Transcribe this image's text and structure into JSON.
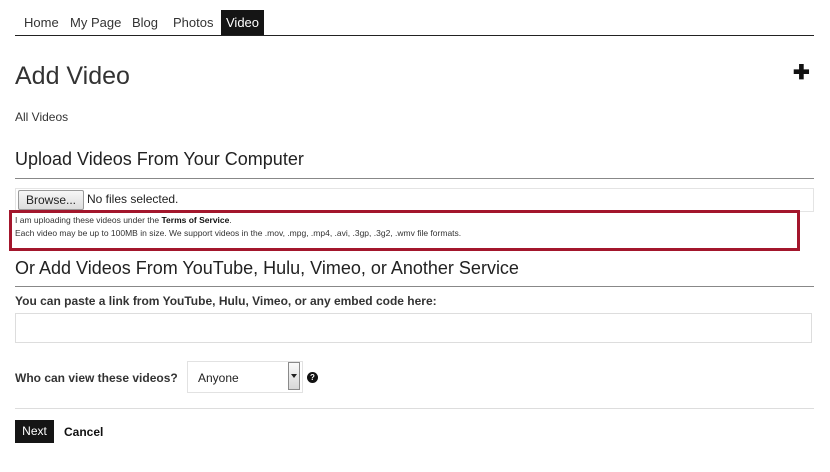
{
  "nav": {
    "items": [
      {
        "label": "Home"
      },
      {
        "label": "My Page"
      },
      {
        "label": "Blog"
      },
      {
        "label": "Photos"
      },
      {
        "label": "Video"
      }
    ],
    "active": "Video"
  },
  "page": {
    "title": "Add Video",
    "add_icon": "plus-icon",
    "all_videos_link": "All Videos"
  },
  "upload": {
    "title": "Upload Videos From Your Computer",
    "browse_label": "Browse...",
    "file_status": "No files selected.",
    "terms_prefix": "I am uploading these videos under the ",
    "terms_link": "Terms of Service",
    "terms_suffix": ".",
    "size_note": "Each video may be up to 100MB in size. We support videos in the .mov, .mpg, .mp4, .avi, .3gp, .3g2, .wmv file formats."
  },
  "service": {
    "title": "Or Add Videos From YouTube, Hulu, Vimeo, or Another Service",
    "field_label": "You can paste a link from YouTube, Hulu, Vimeo, or any embed code here:",
    "field_value": ""
  },
  "privacy": {
    "label": "Who can view these videos?",
    "selected": "Anyone",
    "help_icon": "question-icon"
  },
  "actions": {
    "next_label": "Next",
    "cancel_label": "Cancel"
  },
  "colors": {
    "highlight_border": "#a3162c",
    "nav_active_bg": "#151515",
    "button_bg": "#151515"
  }
}
